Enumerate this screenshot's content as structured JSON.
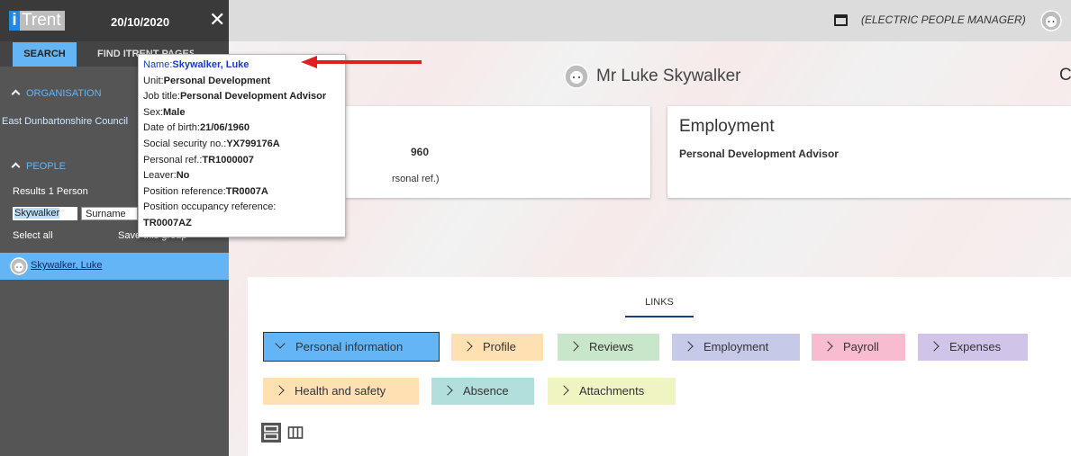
{
  "app": {
    "logo_i": "i",
    "logo_text": "Trent",
    "date": "20/10/2020",
    "close_glyph": "✕",
    "role": "(ELECTRIC PEOPLE MANAGER)"
  },
  "sidebar": {
    "tabs": [
      {
        "label": "SEARCH"
      },
      {
        "label": "FIND ITRENT PAGES"
      }
    ],
    "organisation_header": "ORGANISATION",
    "organisation_item": "East Dunbartonshire Council",
    "people_header": "PEOPLE",
    "results": "Results 1 Person",
    "filter_value": "Skywalker",
    "filter_type": "Surname",
    "select_all": "Select all",
    "save_group": "Save this group",
    "person_name": "Skywalker, Luke"
  },
  "tooltip": {
    "rows": [
      {
        "label": "Name:",
        "value": "Skywalker, Luke"
      },
      {
        "label": "Unit:",
        "value": "Personal Development"
      },
      {
        "label": "Job title:",
        "value": "Personal Development Advisor"
      },
      {
        "label": "Sex:",
        "value": "Male"
      },
      {
        "label": "Date of birth:",
        "value": "21/06/1960"
      },
      {
        "label": "Social security no.:",
        "value": "YX799176A"
      },
      {
        "label": "Personal ref.:",
        "value": "TR1000007"
      },
      {
        "label": "Leaver:",
        "value": "No"
      },
      {
        "label": "Position reference:",
        "value": "TR0007A"
      },
      {
        "label": "Position occupancy reference:",
        "value": "TR0007AZ"
      }
    ]
  },
  "main": {
    "person_title": "Mr Luke Skywalker",
    "refresh_glyph": "C",
    "personal_card": {
      "dob_fragment": "960",
      "ref_fragment": "rsonal ref.)"
    },
    "employment_card": {
      "title": "Employment",
      "job": "Personal Development Advisor"
    },
    "links_label": "LINKS",
    "links": [
      {
        "label": "Personal information",
        "color": "#64b5f6",
        "expanded": true
      },
      {
        "label": "Profile",
        "color": "#ffe0b2"
      },
      {
        "label": "Reviews",
        "color": "#c8e6c9"
      },
      {
        "label": "Employment",
        "color": "#c5cae9"
      },
      {
        "label": "Payroll",
        "color": "#f8bbd0"
      },
      {
        "label": "Expenses",
        "color": "#d1c4e9"
      },
      {
        "label": "Health and safety",
        "color": "#ffe0b2"
      },
      {
        "label": "Absence",
        "color": "#b2dfdb"
      },
      {
        "label": "Attachments",
        "color": "#f0f4c3"
      }
    ]
  },
  "colors": {
    "accent": "#64b5f6",
    "sidebar_dark": "#444444",
    "arrow_red": "#e02020"
  }
}
